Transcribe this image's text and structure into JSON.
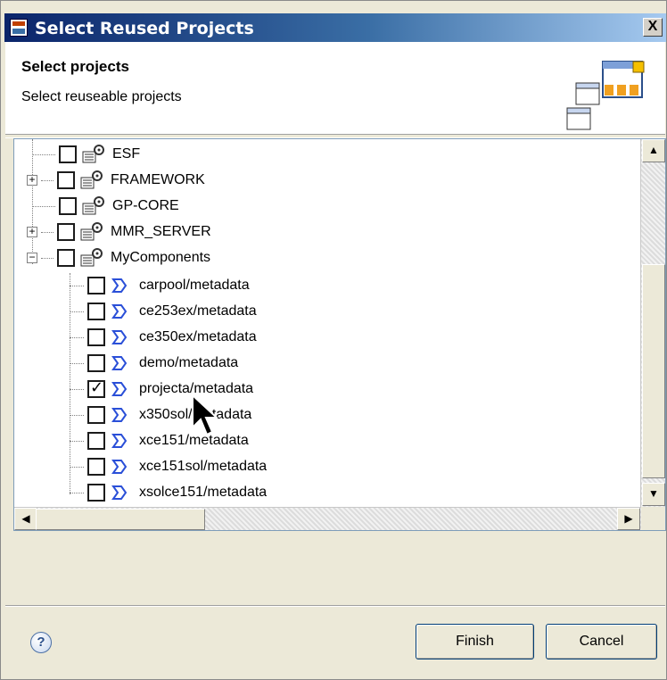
{
  "window": {
    "title": "Select Reused Projects",
    "close_label": "X"
  },
  "banner": {
    "title": "Select projects",
    "description": "Select reuseable projects"
  },
  "tree": {
    "top_items": [
      {
        "label": "ESF",
        "expander": "",
        "checked": false
      },
      {
        "label": "FRAMEWORK",
        "expander": "+",
        "checked": false
      },
      {
        "label": "GP-CORE",
        "expander": "",
        "checked": false
      },
      {
        "label": "MMR_SERVER",
        "expander": "+",
        "checked": false
      },
      {
        "label": "MyComponents",
        "expander": "−",
        "checked": false
      }
    ],
    "children": [
      {
        "label": "carpool/metadata",
        "checked": false
      },
      {
        "label": "ce253ex/metadata",
        "checked": false
      },
      {
        "label": "ce350ex/metadata",
        "checked": false
      },
      {
        "label": "demo/metadata",
        "checked": false
      },
      {
        "label": "projecta/metadata",
        "checked": true
      },
      {
        "label": "x350sol/metadata",
        "checked": false
      },
      {
        "label": "xce151/metadata",
        "checked": false
      },
      {
        "label": "xce151sol/metadata",
        "checked": false
      },
      {
        "label": "xsolce151/metadata",
        "checked": false
      }
    ]
  },
  "scrollbars": {
    "up": "▲",
    "down": "▼",
    "left": "◀",
    "right": "▶"
  },
  "footer": {
    "help_symbol": "?",
    "finish_label": "Finish",
    "cancel_label": "Cancel"
  }
}
